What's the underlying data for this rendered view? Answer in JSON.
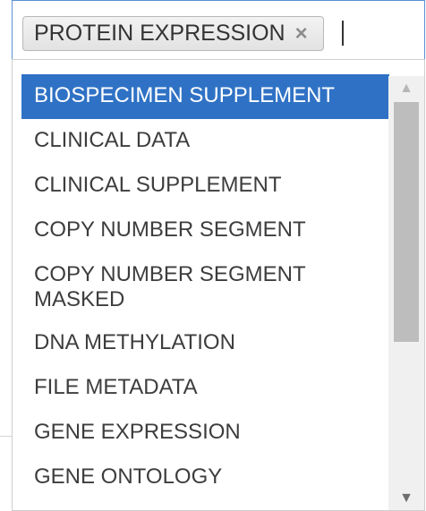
{
  "multiselect": {
    "selected_chip": {
      "label": "PROTEIN EXPRESSION",
      "remove_icon": "×"
    }
  },
  "dropdown": {
    "options": [
      {
        "label": "BIOSPECIMEN SUPPLEMENT",
        "highlighted": true
      },
      {
        "label": "CLINICAL DATA",
        "highlighted": false
      },
      {
        "label": "CLINICAL SUPPLEMENT",
        "highlighted": false
      },
      {
        "label": "COPY NUMBER SEGMENT",
        "highlighted": false
      },
      {
        "label": "COPY NUMBER SEGMENT MASKED",
        "highlighted": false
      },
      {
        "label": "DNA METHYLATION",
        "highlighted": false
      },
      {
        "label": "FILE METADATA",
        "highlighted": false
      },
      {
        "label": "GENE EXPRESSION",
        "highlighted": false
      },
      {
        "label": "GENE ONTOLOGY",
        "highlighted": false
      }
    ]
  },
  "scrollbar": {
    "up_arrow": "▲",
    "down_arrow": "▼"
  },
  "colors": {
    "highlight": "#2f72c5",
    "focus_border": "#5b8fd6",
    "text": "#3d3d3d"
  }
}
